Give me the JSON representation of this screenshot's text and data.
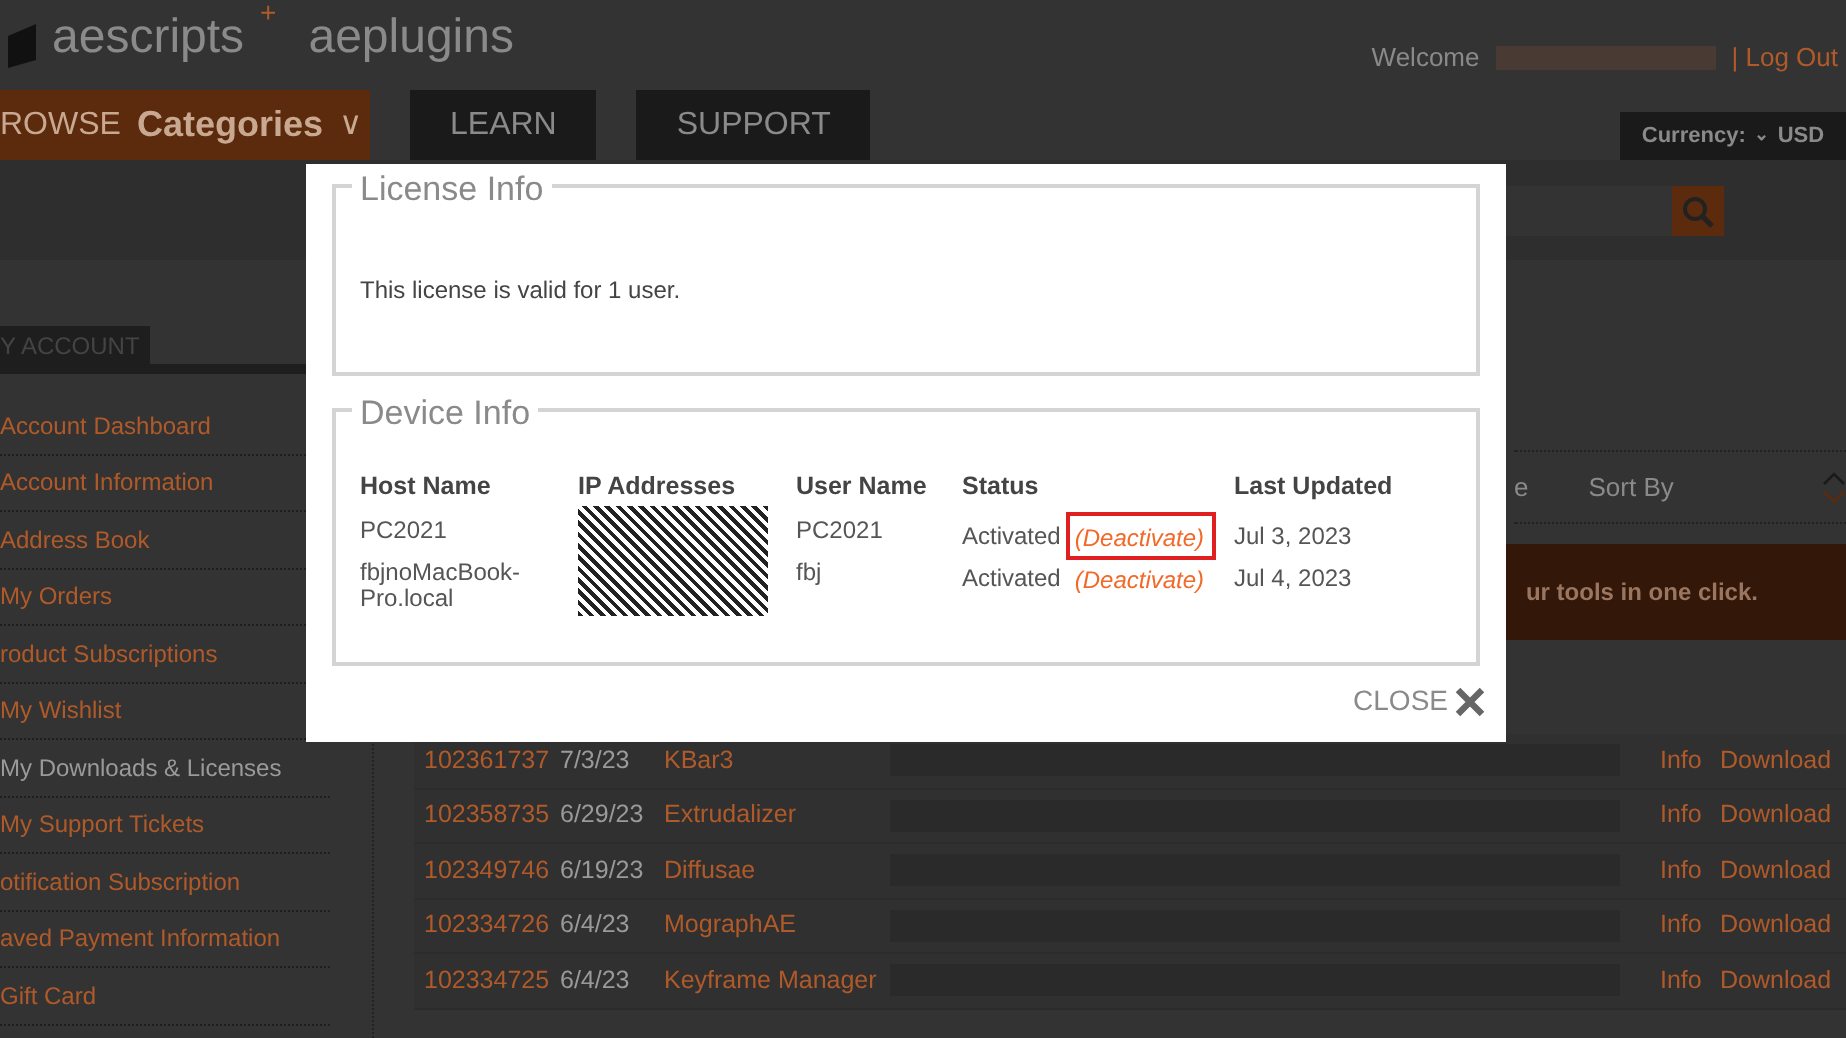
{
  "header": {
    "logo_left": "aescripts",
    "logo_plus": "+",
    "logo_right": "aeplugins",
    "welcome": "Welcome",
    "log_out": "| Log Out"
  },
  "nav": {
    "browse": "ROWSE",
    "categories": "Categories",
    "caret": "∨",
    "tabs": [
      {
        "label": "LEARN"
      },
      {
        "label": "SUPPORT"
      }
    ],
    "currency_label": "Currency:",
    "currency_caret": "⌄",
    "currency_value": "USD"
  },
  "sidebar": {
    "title": "Y ACCOUNT",
    "items": [
      {
        "label": "Account Dashboard",
        "selected": false
      },
      {
        "label": "Account Information",
        "selected": false
      },
      {
        "label": "Address Book",
        "selected": false
      },
      {
        "label": "My Orders",
        "selected": false
      },
      {
        "label": "roduct Subscriptions",
        "selected": false
      },
      {
        "label": "My Wishlist",
        "selected": false
      },
      {
        "label": "My Downloads & Licenses",
        "selected": true
      },
      {
        "label": "My Support Tickets",
        "selected": false
      },
      {
        "label": "otification Subscription",
        "selected": false
      },
      {
        "label": "aved Payment Information",
        "selected": false
      },
      {
        "label": "Gift Card",
        "selected": false
      }
    ]
  },
  "main": {
    "column_fragment": "e",
    "sort_label": "Sort By",
    "banner": "ur tools in one click.",
    "orders": [
      {
        "order": "102361737",
        "date": "7/3/23",
        "product": "KBar3",
        "info": "Info",
        "download": "Download"
      },
      {
        "order": "102358735",
        "date": "6/29/23",
        "product": "Extrudalizer",
        "info": "Info",
        "download": "Download"
      },
      {
        "order": "102349746",
        "date": "6/19/23",
        "product": "Diffusae",
        "info": "Info",
        "download": "Download"
      },
      {
        "order": "102334726",
        "date": "6/4/23",
        "product": "MographAE",
        "info": "Info",
        "download": "Download"
      },
      {
        "order": "102334725",
        "date": "6/4/23",
        "product": "Keyframe Manager",
        "info": "Info",
        "download": "Download"
      }
    ]
  },
  "modal": {
    "license_title": "License Info",
    "license_text": "This license is valid for 1 user.",
    "device_title": "Device Info",
    "columns": [
      "Host Name",
      "IP Addresses",
      "User Name",
      "Status",
      "Last Updated"
    ],
    "devices": [
      {
        "host": "PC2021",
        "user": "PC2021",
        "status": "Activated",
        "action": "(Deactivate)",
        "highlighted": true,
        "updated": "Jul 3, 2023"
      },
      {
        "host": "fbjnoMacBook-Pro.local",
        "user": "fbj",
        "status": "Activated",
        "action": "(Deactivate)",
        "highlighted": false,
        "updated": "Jul 4, 2023"
      }
    ],
    "close": "CLOSE"
  }
}
